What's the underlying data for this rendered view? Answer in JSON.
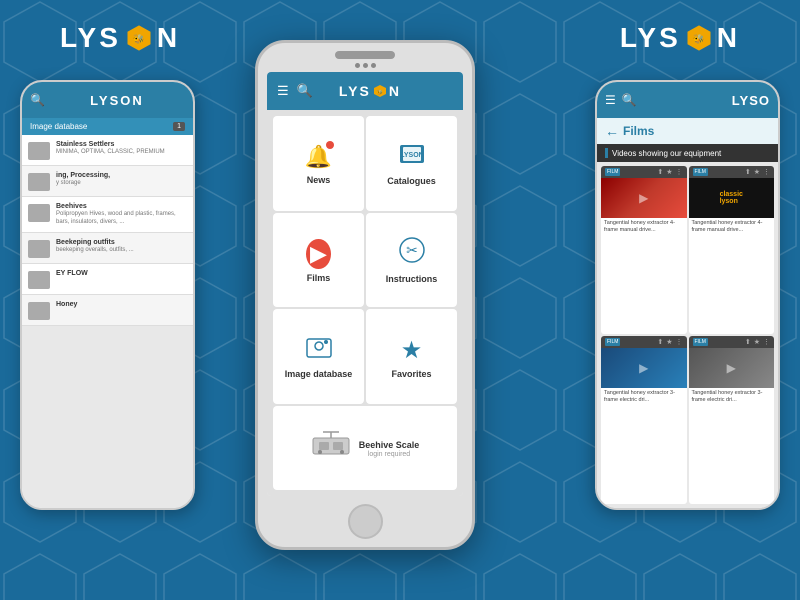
{
  "background_color": "#1a6a9a",
  "logo": {
    "text_left": "LYS",
    "text_right": "N",
    "hex_symbol": "⬡"
  },
  "left_phone": {
    "header": {
      "search_icon": "🔍",
      "logo": "LYSON"
    },
    "breadcrumb": "Image database",
    "items": [
      {
        "title": "Stainless Settlers",
        "desc": "MINIMA, OPTIMA, CLASSIC, PREMIUM"
      },
      {
        "title": "ing, Processing, y storage",
        "desc": ""
      },
      {
        "title": "Beehives",
        "desc": "Polipropyen Hives, wood and plastic, frames, bars, insulators, divers, ..."
      },
      {
        "title": "Beekeping outfits",
        "desc": "beekeping overalls, outfits, ..."
      },
      {
        "title": "EY FLOW",
        "desc": ""
      },
      {
        "title": "Honey",
        "desc": ""
      }
    ]
  },
  "center_phone": {
    "header": {
      "hamburger": "☰",
      "search": "🔍",
      "logo": "LYSON"
    },
    "menu_items": [
      {
        "id": "news",
        "label": "News",
        "icon": "🔔",
        "has_notif": true
      },
      {
        "id": "catalogues",
        "label": "Catalogues",
        "icon": "📘"
      },
      {
        "id": "films",
        "label": "Films",
        "icon": "▶"
      },
      {
        "id": "instructions",
        "label": "Instructions",
        "icon": "✂"
      },
      {
        "id": "image_database",
        "label": "Image database",
        "icon": "📷"
      },
      {
        "id": "favorites",
        "label": "Favorites",
        "icon": "★"
      },
      {
        "id": "beehive_scale",
        "label": "Beehive Scale",
        "icon": "⚖",
        "sub": "login required",
        "wide": true
      }
    ]
  },
  "right_phone": {
    "header": {
      "hamburger": "☰",
      "search": "🔍",
      "logo": "LYSO"
    },
    "back": "←",
    "section_title": "Films",
    "section_subtitle": "Videos showing our equipment",
    "videos": [
      {
        "tag": "FILM",
        "desc": "Tangential honey extractor 4-frame manual drive...",
        "thumb_type": "red"
      },
      {
        "tag": "FILM",
        "desc": "Tangential honey extractor 4-frame manual drive...",
        "thumb_type": "logo"
      },
      {
        "tag": "FILM",
        "desc": "Tangential honey extractor 3-frame electric dri...",
        "thumb_type": "blue"
      },
      {
        "tag": "FILM",
        "desc": "Tangential honey extractor 3-frame electric dri...",
        "thumb_type": "gray"
      }
    ]
  }
}
